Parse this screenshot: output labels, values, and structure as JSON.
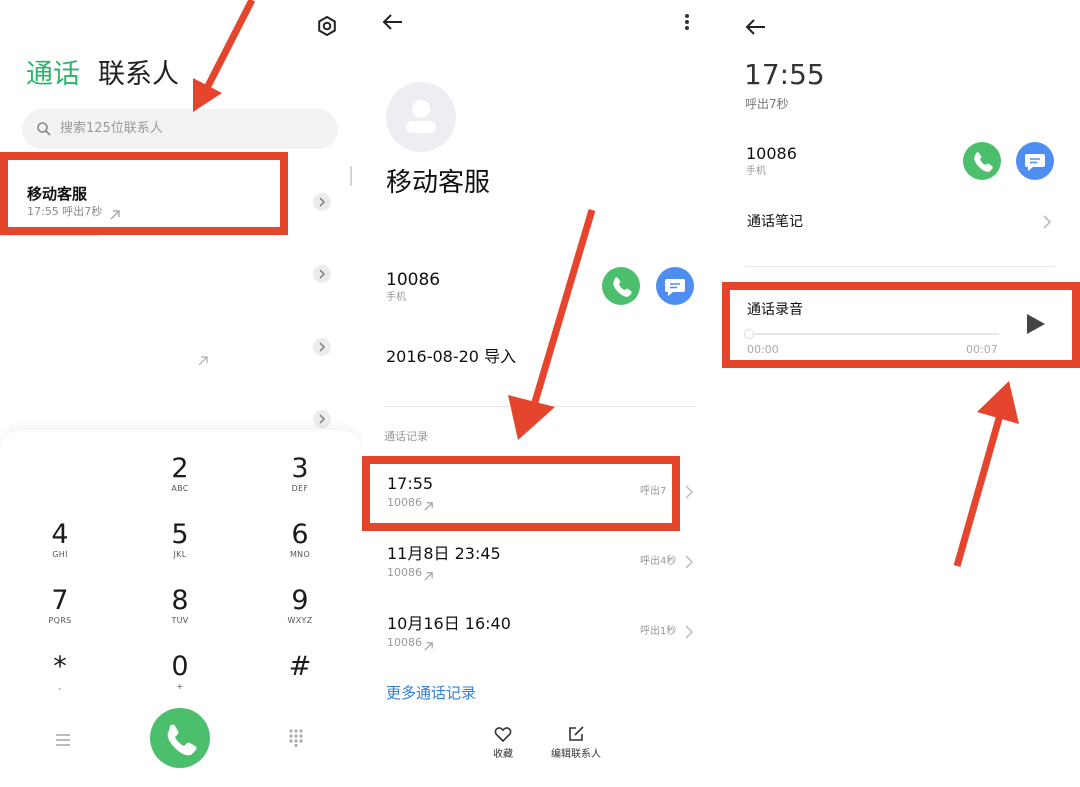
{
  "panel1": {
    "tab_calls": "通话",
    "tab_contacts": "联系人",
    "search_placeholder": "搜索125位联系人",
    "first_call": {
      "name": "移动客服",
      "detail": "17:55 呼出7秒"
    },
    "keypad": [
      {
        "digit": "2",
        "letters": "ABC"
      },
      {
        "digit": "3",
        "letters": "DEF"
      },
      {
        "digit": "4",
        "letters": "GHI"
      },
      {
        "digit": "5",
        "letters": "JKL"
      },
      {
        "digit": "6",
        "letters": "MNO"
      },
      {
        "digit": "7",
        "letters": "PQRS"
      },
      {
        "digit": "8",
        "letters": "TUV"
      },
      {
        "digit": "9",
        "letters": "WXYZ"
      },
      {
        "digit": "*",
        "letters": ","
      },
      {
        "digit": "0",
        "letters": "+"
      },
      {
        "digit": "#",
        "letters": ""
      }
    ]
  },
  "panel2": {
    "contact_name": "移动客服",
    "phone_number": "10086",
    "phone_type": "手机",
    "import_date": "2016-08-20 导入",
    "section_title": "通话记录",
    "records": [
      {
        "time": "17:55",
        "number": "10086",
        "duration": "呼出7"
      },
      {
        "time": "11月8日 23:45",
        "number": "10086",
        "duration": "呼出4秒"
      },
      {
        "time": "10月16日 16:40",
        "number": "10086",
        "duration": "呼出1秒"
      }
    ],
    "more_records": "更多通话记录",
    "favorite_label": "收藏",
    "edit_label": "编辑联系人"
  },
  "panel3": {
    "time": "17:55",
    "call_info": "呼出7秒",
    "number": "10086",
    "number_type": "手机",
    "notes_label": "通话笔记",
    "recording_title": "通话录音",
    "recording_start": "00:00",
    "recording_end": "00:07",
    "recording_progress": 0
  },
  "colors": {
    "accent_green": "#2fb36d",
    "call_green": "#4bbf6b",
    "message_blue": "#4d8ef0",
    "link_blue": "#2f7fd8",
    "annotation_red": "#e4452c"
  }
}
